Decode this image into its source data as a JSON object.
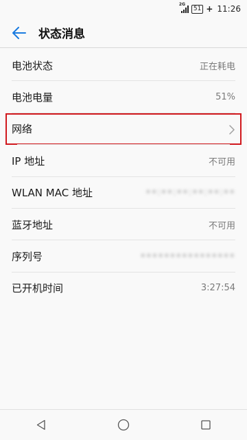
{
  "status_bar": {
    "network": "2G",
    "battery": "51",
    "time": "11:26"
  },
  "header": {
    "title": "状态消息",
    "back_icon": "arrow-left-icon",
    "accent_color": "#1a7be0"
  },
  "rows": [
    {
      "label": "电池状态",
      "value": "正在耗电"
    },
    {
      "label": "电池电量",
      "value": "51%"
    },
    {
      "label": "网络",
      "value": ""
    },
    {
      "label": "IP 地址",
      "value": "不可用"
    },
    {
      "label": "WLAN MAC 地址",
      "value": "••:••:••:••:••:••"
    },
    {
      "label": "蓝牙地址",
      "value": "不可用"
    },
    {
      "label": "序列号",
      "value": "••••••••••••••••"
    },
    {
      "label": "已开机时间",
      "value": "3:27:54"
    }
  ],
  "highlight_color": "#d0171c",
  "nav": {
    "back": "triangle-back-icon",
    "home": "circle-home-icon",
    "recent": "square-recent-icon"
  }
}
